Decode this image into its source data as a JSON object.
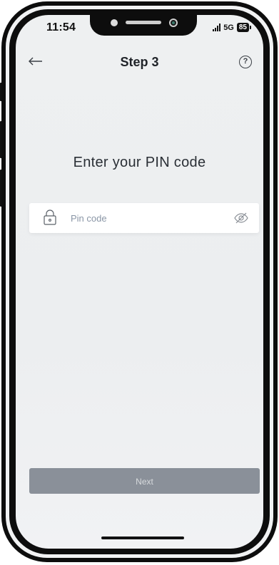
{
  "status_bar": {
    "time": "11:54",
    "network": "5G",
    "battery": "85"
  },
  "header": {
    "title": "Step 3",
    "back_icon": "arrow-left-icon",
    "help_label": "?"
  },
  "main": {
    "prompt": "Enter your PIN code",
    "pin_field": {
      "placeholder": "Pin code",
      "value": "",
      "lock_icon": "lock-icon",
      "visibility_icon": "eye-off-icon"
    }
  },
  "footer": {
    "next_label": "Next"
  },
  "colors": {
    "screen_bg": "#eef0f1",
    "button_disabled": "#8a9099",
    "placeholder": "#8a96a6",
    "frame": "#0d0d0d"
  }
}
